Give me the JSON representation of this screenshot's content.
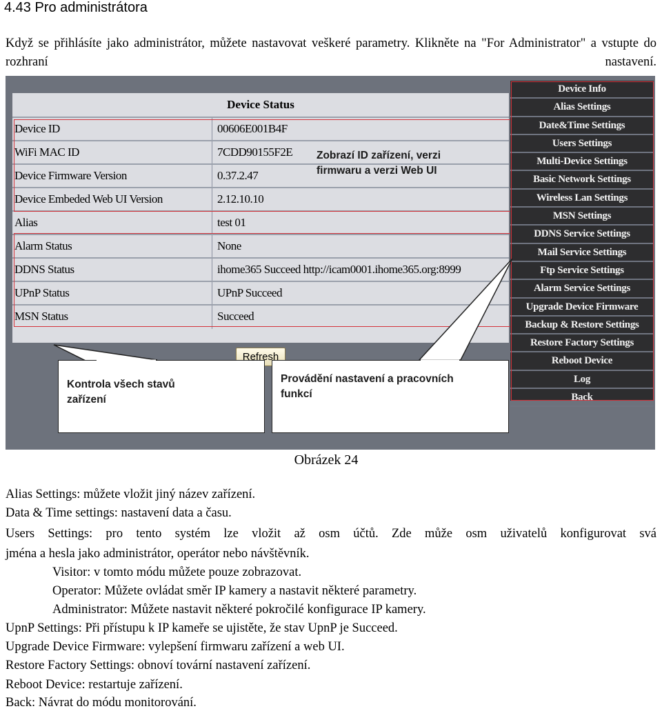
{
  "heading": "4.43 Pro administrátora",
  "intro": "Když se přihlásíte jako administrátor, můžete nastavovat veškeré parametry. Klikněte na \"For Administrator\" a vstupte do rozhraní nastavení.",
  "screenshot": {
    "table_title": "Device Status",
    "rows": [
      {
        "key": "Device ID",
        "value": "00606E001B4F"
      },
      {
        "key": "WiFi MAC ID",
        "value": "7CDD90155F2E"
      },
      {
        "key": "Device Firmware Version",
        "value": "0.37.2.47"
      },
      {
        "key": "Device Embeded Web UI Version",
        "value": "2.12.10.10"
      },
      {
        "key": "Alias",
        "value": "test 01"
      },
      {
        "key": "Alarm Status",
        "value": "None"
      },
      {
        "key": "DDNS Status",
        "value": "ihome365 Succeed  http://icam0001.ihome365.org:8999"
      },
      {
        "key": "UPnP Status",
        "value": "UPnP Succeed"
      },
      {
        "key": "MSN Status",
        "value": "Succeed"
      }
    ],
    "refresh_label": "Refresh",
    "annotation_ids": "Zobrazí ID zařízení, verzi firmwaru a verzi Web UI",
    "callout_status": "Kontrola všech stavů zařízení",
    "callout_settings": "Provádění nastavení a pracovních funkcí",
    "menu": [
      "Device Info",
      "Alias Settings",
      "Date&Time Settings",
      "Users Settings",
      "Multi-Device Settings",
      "Basic Network Settings",
      "Wireless Lan Settings",
      "MSN Settings",
      "DDNS Service Settings",
      "Mail Service Settings",
      "Ftp Service Settings",
      "Alarm Service Settings",
      "Upgrade Device Firmware",
      "Backup & Restore Settings",
      "Restore Factory Settings",
      "Reboot Device",
      "Log",
      "Back"
    ],
    "highlight_color": "#d4323a"
  },
  "caption": "Obrázek 24",
  "lines": [
    "Alias Settings: můžete vložit jiný název zařízení.",
    "Data & Time settings: nastavení data a času.",
    "Users Settings: pro tento systém lze vložit až osm účtů. Zde může osm uživatelů konfigurovat svá",
    "jména a hesla jako administrátor, operátor nebo návštěvník.",
    "Visitor: v tomto módu můžete pouze zobrazovat.",
    "Operator: Můžete ovládat směr IP kamery a nastavit některé parametry.",
    "Administrator: Můžete nastavit některé pokročilé konfigurace IP kamery.",
    "UpnP Settings: Při přístupu k IP kameře se ujistěte, že stav UpnP je Succeed.",
    "Upgrade Device Firmware: vylepšení firmwaru zařízení a web UI.",
    "Restore Factory Settings: obnoví tovární nastavení zařízení.",
    "Reboot Device: restartuje zařízení.",
    "Back: Návrat do módu monitorování."
  ]
}
